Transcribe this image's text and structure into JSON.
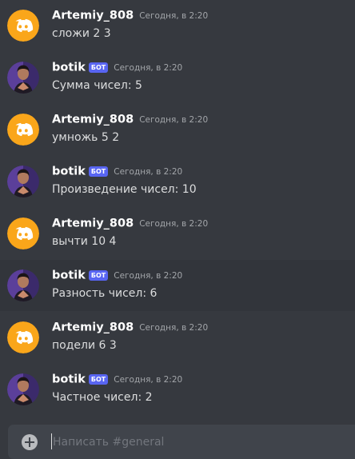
{
  "messages": [
    {
      "author": "Artemiy_808",
      "is_bot": false,
      "timestamp": "Сегодня, в 2:20",
      "text": "сложи 2 3"
    },
    {
      "author": "botik",
      "is_bot": true,
      "bot_tag": "БОТ",
      "timestamp": "Сегодня, в 2:20",
      "text": "Сумма чисел: 5"
    },
    {
      "author": "Artemiy_808",
      "is_bot": false,
      "timestamp": "Сегодня, в 2:20",
      "text": "умножь 5 2"
    },
    {
      "author": "botik",
      "is_bot": true,
      "bot_tag": "БОТ",
      "timestamp": "Сегодня, в 2:20",
      "text": "Произведение чисел: 10"
    },
    {
      "author": "Artemiy_808",
      "is_bot": false,
      "timestamp": "Сегодня, в 2:20",
      "text": "вычти 10 4"
    },
    {
      "author": "botik",
      "is_bot": true,
      "bot_tag": "БОТ",
      "timestamp": "Сегодня, в 2:20",
      "text": "Разность чисел: 6",
      "highlighted": true
    },
    {
      "author": "Artemiy_808",
      "is_bot": false,
      "timestamp": "Сегодня, в 2:20",
      "text": "подели 6 3"
    },
    {
      "author": "botik",
      "is_bot": true,
      "bot_tag": "БОТ",
      "timestamp": "Сегодня, в 2:20",
      "text": "Частное чисел: 2"
    }
  ],
  "avatars": {
    "user": {
      "icon": "discord-logo-icon",
      "color": "#faa61a"
    },
    "bot": {
      "icon": "bot-avatar-icon",
      "color": "#3b2a6b"
    }
  },
  "composer": {
    "placeholder": "Написать #general",
    "value": ""
  },
  "colors": {
    "background": "#36393f",
    "bot_tag": "#5865f2",
    "composer": "#40444b"
  }
}
